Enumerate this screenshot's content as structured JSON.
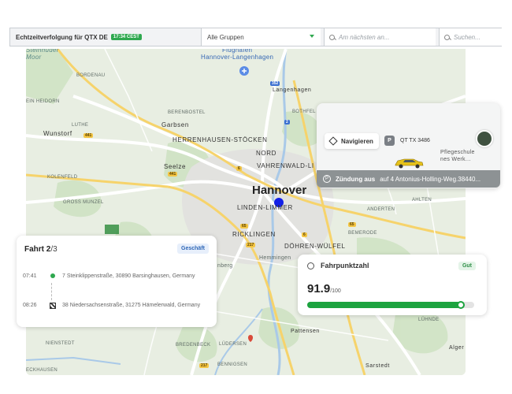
{
  "header": {
    "title": "Echtzeitverfolgung für QTX DE",
    "time_badge": "17:34 CEST",
    "group_select": "Alle Gruppen",
    "near_placeholder": "Am nächsten an...",
    "search_placeholder": "Suchen..."
  },
  "map": {
    "labels": {
      "steinhuder_meer": "Steinhuder\nMoor",
      "bordenau": "BORDENAU",
      "hein_isborn": "EIN HEIDORN",
      "berenbostel": "BERENBOSTEL",
      "garbsen": "Garbsen",
      "luthe": "LUTHE",
      "wunstorf": "Wunstorf",
      "kolenfeld": "KOLENFELD",
      "gross_munzel": "GROSS MUNZEL",
      "seelze": "Seelze",
      "herrenhausen": "HERRENHAUSEN-STÖCKEN",
      "nord": "NORD",
      "vahrenwald": "VAHRENWALD-LI",
      "hannover": "Hannover",
      "linden": "LINDEN-LIMMER",
      "ricklingen": "RICKLINGEN",
      "doehren": "DÖHREN-WÜLFEL",
      "hemmingen": "Hemmingen",
      "ronnenberg": "nberg",
      "airport": "Flughafen\nHannover-Langenhagen",
      "langenhagen": "Langenhagen",
      "bothfeld": "BOTHFEL",
      "anderten": "ANDERTEN",
      "ahlten": "AHLTEN",
      "bemerode": "BEMERODE",
      "luehnde": "LÜHNDE",
      "pattensen": "Pattensen",
      "algermissen": "Alger",
      "sarstedt": "Sarstedt",
      "niensted": "NIENSTEDT",
      "bredenbeck": "BREDENBECK",
      "luedersen": "LÜDERSEN",
      "bennigsen": "BENNIGSEN",
      "eckhausen": "ECKHAUSEN",
      "pflegeschule": "Pflegeschule\nnes Werk..."
    },
    "shields": {
      "a352": "352",
      "a2": "2",
      "a441": "441",
      "a441b": "441",
      "a6": "6",
      "a65": "65",
      "a217": "217",
      "a6b": "6",
      "a6c": "6",
      "a65b": "65",
      "a217b": "217",
      "a3": "3"
    }
  },
  "vehicle": {
    "navigate_label": "Navigieren",
    "vehicle_id": "QT TX 3486",
    "parking_glyph": "P",
    "ignition_label": "Zündung aus",
    "ignition_location": "auf 4 Antonius-Holling-Weg.38440..."
  },
  "trip": {
    "label": "Fahrt",
    "current": "2",
    "total": "/3",
    "category": "Geschäft",
    "stops": [
      {
        "time": "07:41",
        "address": "7 Steinklippenstraße, 30890 Barsinghausen, Germany"
      },
      {
        "time": "08:26",
        "address": "38 Niedersachsenstraße, 31275 Hämelerwald, Germany"
      }
    ]
  },
  "score": {
    "title": "Fahrpunktzahl",
    "rating": "Gut",
    "value": "91.9",
    "max": "/100",
    "fraction": 0.919
  },
  "colors": {
    "accent_green": "#2fa84f",
    "progress_green": "#1ca33f",
    "link_blue": "#2f67b7",
    "marker_blue": "#1320e8"
  }
}
